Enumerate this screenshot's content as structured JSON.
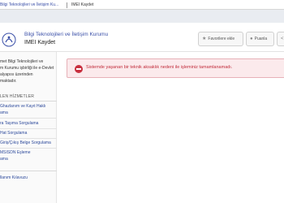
{
  "browser": {
    "tabs": [
      {
        "label": "Bilgi Teknolojileri ve İletişim Ku..."
      },
      {
        "label": "IMEI Kaydet"
      }
    ]
  },
  "header": {
    "org_name": "Bilgi Teknolojileri ve İletişim Kurumu",
    "service_name": "IMEI Kaydet",
    "buttons": [
      {
        "label": "Favorilere ekle",
        "icon": "star-icon"
      },
      {
        "label": "Puanla",
        "icon": "chat-bubble-icon"
      }
    ]
  },
  "sidebar": {
    "intro_lines": [
      "met Bilgi Teknolojileri ve",
      "m Kurumu işbirliği ile e-Devlet",
      "alyapısı üzerinden",
      "maktadır."
    ],
    "services_title": "LEN HİZMETLER",
    "services": [
      {
        "lines": [
          "Ghazlanım ve Kayıt Haklı",
          "ama"
        ]
      },
      {
        "lines": [
          "ra Taşıma Sorgulama"
        ]
      },
      {
        "lines": [
          "Hat Sorgulama"
        ]
      },
      {
        "lines": [
          "Giriş/Çıkış Belge Sorgulama"
        ]
      },
      {
        "lines": [
          "MSISDN Eşleme",
          "ama"
        ]
      }
    ],
    "guide_link": "llanım Kılavuzu"
  },
  "alert": {
    "message": "Sistemde yaşanan bir teknik aksaklık nedeni ile işleminiz tamamlanamadı.",
    "color": "#c8303f"
  }
}
